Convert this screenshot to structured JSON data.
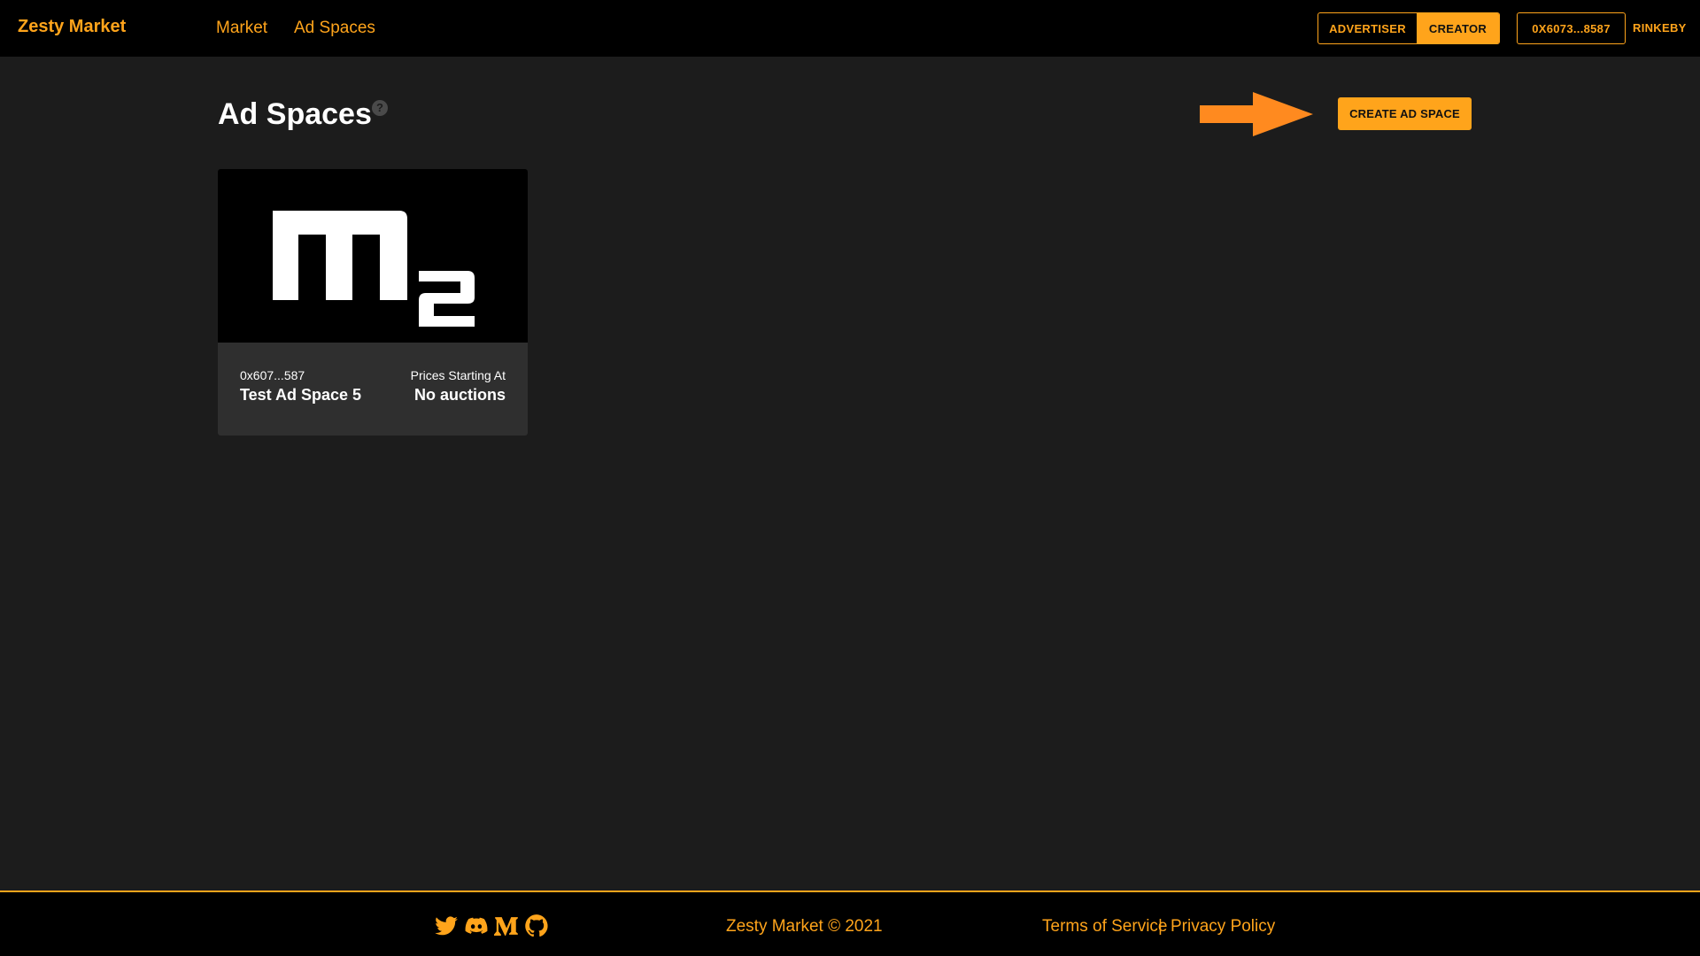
{
  "header": {
    "brand": "Zesty Market",
    "nav": {
      "market": "Market",
      "ad_spaces": "Ad Spaces"
    },
    "roles": {
      "advertiser": "ADVERTISER",
      "creator": "CREATOR",
      "active": "CREATOR"
    },
    "wallet": "0X6073...8587",
    "network": "RINKEBY"
  },
  "main": {
    "title": "Ad Spaces",
    "help_icon": "?",
    "create_button": "CREATE AD SPACE",
    "cards": [
      {
        "logo": "m2",
        "owner": "0x607...587",
        "name": "Test Ad Space 5",
        "price_label": "Prices Starting At",
        "price": "No auctions"
      }
    ]
  },
  "footer": {
    "social_icons": [
      "twitter-icon",
      "discord-icon",
      "medium-icon",
      "github-icon"
    ],
    "copyright": "Zesty Market © 2021",
    "terms": "Terms of Service",
    "separator": "|",
    "privacy": "Privacy Policy"
  },
  "colors": {
    "accent": "#ffa41b",
    "arrow": "#ff8a1f",
    "background": "#1c1c1c",
    "bar": "#000000",
    "card": "#2f2f2f"
  }
}
